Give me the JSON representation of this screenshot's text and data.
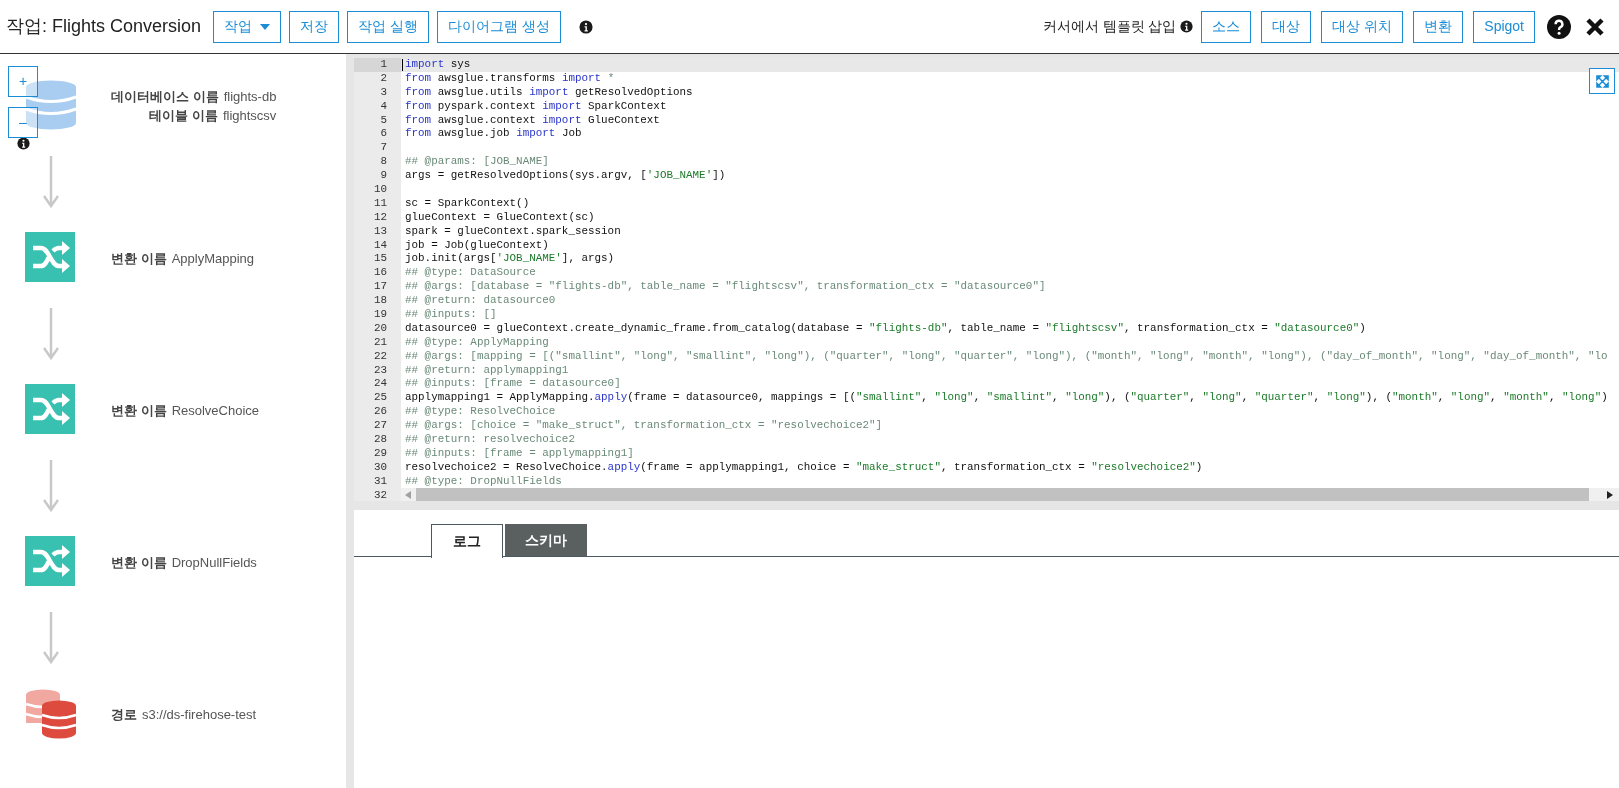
{
  "header": {
    "title": "작업: Flights Conversion",
    "actions": [
      {
        "label": "작업",
        "dropdown": true
      },
      {
        "label": "저장",
        "dropdown": false
      },
      {
        "label": "작업 실행",
        "dropdown": false
      },
      {
        "label": "다이어그램 생성",
        "dropdown": false
      }
    ],
    "insert_label": "커서에서 템플릿 삽입",
    "insert_buttons": [
      "소스",
      "대상",
      "대상 위치",
      "변환",
      "Spigot"
    ]
  },
  "zoom_controls": [
    "+",
    "–"
  ],
  "diagram": [
    {
      "kind": "source",
      "rows": [
        {
          "label": "데이터베이스 이름",
          "value": "flights-db"
        },
        {
          "label": "테이블 이름",
          "value": "flightscsv"
        }
      ]
    },
    {
      "kind": "transform",
      "rows": [
        {
          "label": "변환 이름",
          "value": "ApplyMapping"
        }
      ]
    },
    {
      "kind": "transform",
      "rows": [
        {
          "label": "변환 이름",
          "value": "ResolveChoice"
        }
      ]
    },
    {
      "kind": "transform",
      "rows": [
        {
          "label": "변환 이름",
          "value": "DropNullFields"
        }
      ]
    },
    {
      "kind": "target",
      "rows": [
        {
          "label": "경로",
          "value": "s3://ds-firehose-test"
        }
      ]
    }
  ],
  "editor": {
    "lines": [
      {
        "n": "1",
        "active": true,
        "segments": [
          {
            "kind": "kw",
            "t": "import"
          },
          {
            "kind": "plain",
            "t": " sys"
          }
        ]
      },
      {
        "n": "2",
        "active": false,
        "segments": [
          {
            "kind": "kw",
            "t": "from"
          },
          {
            "kind": "plain",
            "t": " awsglue.transforms "
          },
          {
            "kind": "kw",
            "t": "import"
          },
          {
            "kind": "cmt",
            "t": " *"
          }
        ]
      },
      {
        "n": "3",
        "active": false,
        "segments": [
          {
            "kind": "kw",
            "t": "from"
          },
          {
            "kind": "plain",
            "t": " awsglue.utils "
          },
          {
            "kind": "kw",
            "t": "import"
          },
          {
            "kind": "plain",
            "t": " getResolvedOptions"
          }
        ]
      },
      {
        "n": "4",
        "active": false,
        "segments": [
          {
            "kind": "kw",
            "t": "from"
          },
          {
            "kind": "plain",
            "t": " pyspark.context "
          },
          {
            "kind": "kw",
            "t": "import"
          },
          {
            "kind": "plain",
            "t": " SparkContext"
          }
        ]
      },
      {
        "n": "5",
        "active": false,
        "segments": [
          {
            "kind": "kw",
            "t": "from"
          },
          {
            "kind": "plain",
            "t": " awsglue.context "
          },
          {
            "kind": "kw",
            "t": "import"
          },
          {
            "kind": "plain",
            "t": " GlueContext"
          }
        ]
      },
      {
        "n": "6",
        "active": false,
        "segments": [
          {
            "kind": "kw",
            "t": "from"
          },
          {
            "kind": "plain",
            "t": " awsglue.job "
          },
          {
            "kind": "kw",
            "t": "import"
          },
          {
            "kind": "plain",
            "t": " Job"
          }
        ]
      },
      {
        "n": "7",
        "active": false
      },
      {
        "n": "8",
        "active": false,
        "segments": [
          {
            "kind": "cmt",
            "t": "## @params: [JOB_NAME]"
          }
        ]
      },
      {
        "n": "9",
        "active": false,
        "segments": [
          {
            "kind": "plain",
            "t": "args = getResolvedOptions(sys.argv, ["
          },
          {
            "kind": "str",
            "t": "'JOB_NAME'"
          },
          {
            "kind": "plain",
            "t": "])"
          }
        ]
      },
      {
        "n": "10",
        "active": false
      },
      {
        "n": "11",
        "active": false,
        "segments": [
          {
            "kind": "plain",
            "t": "sc = SparkContext()"
          }
        ]
      },
      {
        "n": "12",
        "active": false,
        "segments": [
          {
            "kind": "plain",
            "t": "glueContext = GlueContext(sc)"
          }
        ]
      },
      {
        "n": "13",
        "active": false,
        "segments": [
          {
            "kind": "plain",
            "t": "spark = glueContext.spark_session"
          }
        ]
      },
      {
        "n": "14",
        "active": false,
        "segments": [
          {
            "kind": "plain",
            "t": "job = Job(glueContext)"
          }
        ]
      },
      {
        "n": "15",
        "active": false,
        "segments": [
          {
            "kind": "plain",
            "t": "job.init(args["
          },
          {
            "kind": "str",
            "t": "'JOB_NAME'"
          },
          {
            "kind": "plain",
            "t": "], args)"
          }
        ]
      },
      {
        "n": "16",
        "active": false,
        "segments": [
          {
            "kind": "cmt",
            "t": "## @type: DataSource"
          }
        ]
      },
      {
        "n": "17",
        "active": false,
        "segments": [
          {
            "kind": "cmt",
            "t": "## @args: [database = \"flights-db\", table_name = \"flightscsv\", transformation_ctx = \"datasource0\"]"
          }
        ]
      },
      {
        "n": "18",
        "active": false,
        "segments": [
          {
            "kind": "cmt",
            "t": "## @return: datasource0"
          }
        ]
      },
      {
        "n": "19",
        "active": false,
        "segments": [
          {
            "kind": "cmt",
            "t": "## @inputs: []"
          }
        ]
      },
      {
        "n": "20",
        "active": false,
        "segments": [
          {
            "kind": "plain",
            "t": "datasource0 = glueContext.create_dynamic_frame.from_catalog(database = "
          },
          {
            "kind": "str",
            "t": "\"flights-db\""
          },
          {
            "kind": "plain",
            "t": ", table_name = "
          },
          {
            "kind": "str",
            "t": "\"flightscsv\""
          },
          {
            "kind": "plain",
            "t": ", transformation_ctx = "
          },
          {
            "kind": "str",
            "t": "\"datasource0\""
          },
          {
            "kind": "plain",
            "t": ")"
          }
        ]
      },
      {
        "n": "21",
        "active": false,
        "segments": [
          {
            "kind": "cmt",
            "t": "## @type: ApplyMapping"
          }
        ]
      },
      {
        "n": "22",
        "active": false,
        "segments": [
          {
            "kind": "cmt",
            "t": "## @args: [mapping = [(\"smallint\", \"long\", \"smallint\", \"long\"), (\"quarter\", \"long\", \"quarter\", \"long\"), (\"month\", \"long\", \"month\", \"long\"), (\"day_of_month\", \"long\", \"day_of_month\", \"lo"
          }
        ]
      },
      {
        "n": "23",
        "active": false,
        "segments": [
          {
            "kind": "cmt",
            "t": "## @return: applymapping1"
          }
        ]
      },
      {
        "n": "24",
        "active": false,
        "segments": [
          {
            "kind": "cmt",
            "t": "## @inputs: [frame = datasource0]"
          }
        ]
      },
      {
        "n": "25",
        "active": false,
        "segments": [
          {
            "kind": "plain",
            "t": "applymapping1 = ApplyMapping."
          },
          {
            "kind": "kw",
            "t": "apply"
          },
          {
            "kind": "plain",
            "t": "(frame = datasource0, mappings = [("
          },
          {
            "kind": "str",
            "t": "\"smallint\""
          },
          {
            "kind": "plain",
            "t": ", "
          },
          {
            "kind": "str",
            "t": "\"long\""
          },
          {
            "kind": "plain",
            "t": ", "
          },
          {
            "kind": "str",
            "t": "\"smallint\""
          },
          {
            "kind": "plain",
            "t": ", "
          },
          {
            "kind": "str",
            "t": "\"long\""
          },
          {
            "kind": "plain",
            "t": "), ("
          },
          {
            "kind": "str",
            "t": "\"quarter\""
          },
          {
            "kind": "plain",
            "t": ", "
          },
          {
            "kind": "str",
            "t": "\"long\""
          },
          {
            "kind": "plain",
            "t": ", "
          },
          {
            "kind": "str",
            "t": "\"quarter\""
          },
          {
            "kind": "plain",
            "t": ", "
          },
          {
            "kind": "str",
            "t": "\"long\""
          },
          {
            "kind": "plain",
            "t": "), ("
          },
          {
            "kind": "str",
            "t": "\"month\""
          },
          {
            "kind": "plain",
            "t": ", "
          },
          {
            "kind": "str",
            "t": "\"long\""
          },
          {
            "kind": "plain",
            "t": ", "
          },
          {
            "kind": "str",
            "t": "\"month\""
          },
          {
            "kind": "plain",
            "t": ", "
          },
          {
            "kind": "str",
            "t": "\"long\""
          },
          {
            "kind": "plain",
            "t": ")"
          }
        ]
      },
      {
        "n": "26",
        "active": false,
        "segments": [
          {
            "kind": "cmt",
            "t": "## @type: ResolveChoice"
          }
        ]
      },
      {
        "n": "27",
        "active": false,
        "segments": [
          {
            "kind": "cmt",
            "t": "## @args: [choice = \"make_struct\", transformation_ctx = \"resolvechoice2\"]"
          }
        ]
      },
      {
        "n": "28",
        "active": false,
        "segments": [
          {
            "kind": "cmt",
            "t": "## @return: resolvechoice2"
          }
        ]
      },
      {
        "n": "29",
        "active": false,
        "segments": [
          {
            "kind": "cmt",
            "t": "## @inputs: [frame = applymapping1]"
          }
        ]
      },
      {
        "n": "30",
        "active": false,
        "segments": [
          {
            "kind": "plain",
            "t": "resolvechoice2 = ResolveChoice."
          },
          {
            "kind": "kw",
            "t": "apply"
          },
          {
            "kind": "plain",
            "t": "(frame = applymapping1, choice = "
          },
          {
            "kind": "str",
            "t": "\"make_struct\""
          },
          {
            "kind": "plain",
            "t": ", transformation_ctx = "
          },
          {
            "kind": "str",
            "t": "\"resolvechoice2\""
          },
          {
            "kind": "plain",
            "t": ")"
          }
        ]
      },
      {
        "n": "31",
        "active": false,
        "segments": [
          {
            "kind": "cmt",
            "t": "## @type: DropNullFields"
          }
        ]
      },
      {
        "n": "32",
        "active": false
      }
    ]
  },
  "tabs": [
    {
      "label": "로그",
      "selected": true
    },
    {
      "label": "스키마",
      "selected": false
    }
  ]
}
